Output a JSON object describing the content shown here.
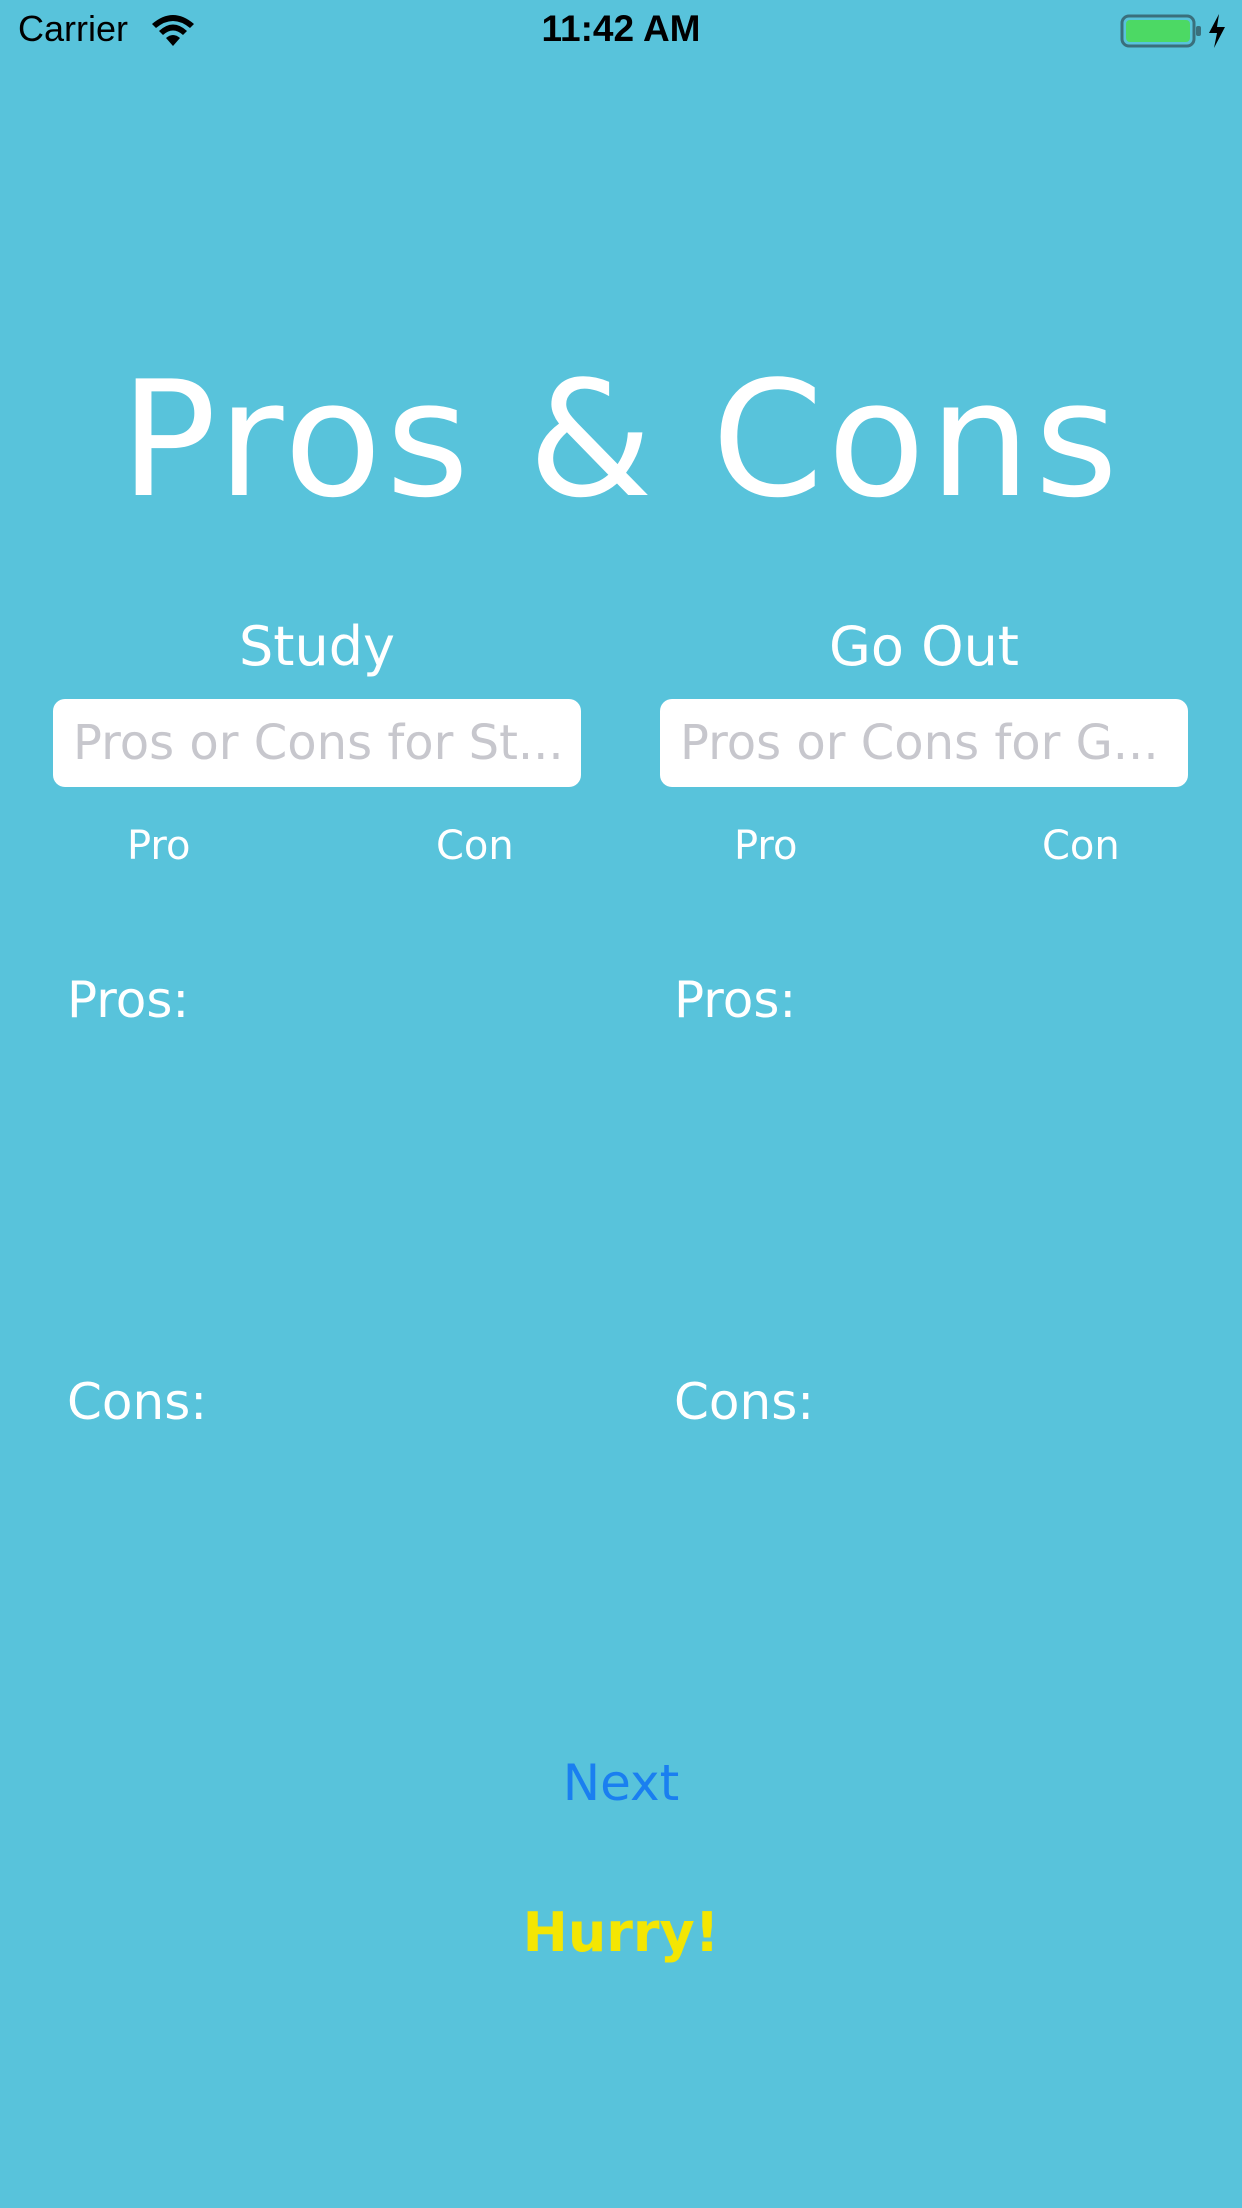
{
  "status_bar": {
    "carrier": "Carrier",
    "time": "11:42 AM",
    "icons": [
      "wifi-icon",
      "battery-icon",
      "charging-bolt-icon"
    ]
  },
  "title": "Pros & Cons",
  "columns": [
    {
      "heading": "Study",
      "input_placeholder": "Pros or Cons for St...",
      "input_value": "",
      "pro_button": "Pro",
      "con_button": "Con",
      "pros_label": "Pros:",
      "cons_label": "Cons:"
    },
    {
      "heading": "Go Out",
      "input_placeholder": "Pros or Cons for G...",
      "input_value": "",
      "pro_button": "Pro",
      "con_button": "Con",
      "pros_label": "Pros:",
      "cons_label": "Cons:"
    }
  ],
  "next_button": "Next",
  "hurry_label": "Hurry!",
  "colors": {
    "background": "#58c3db",
    "next": "#1a7ff0",
    "hurry": "#f4e602",
    "battery_fill": "#4cd964"
  }
}
